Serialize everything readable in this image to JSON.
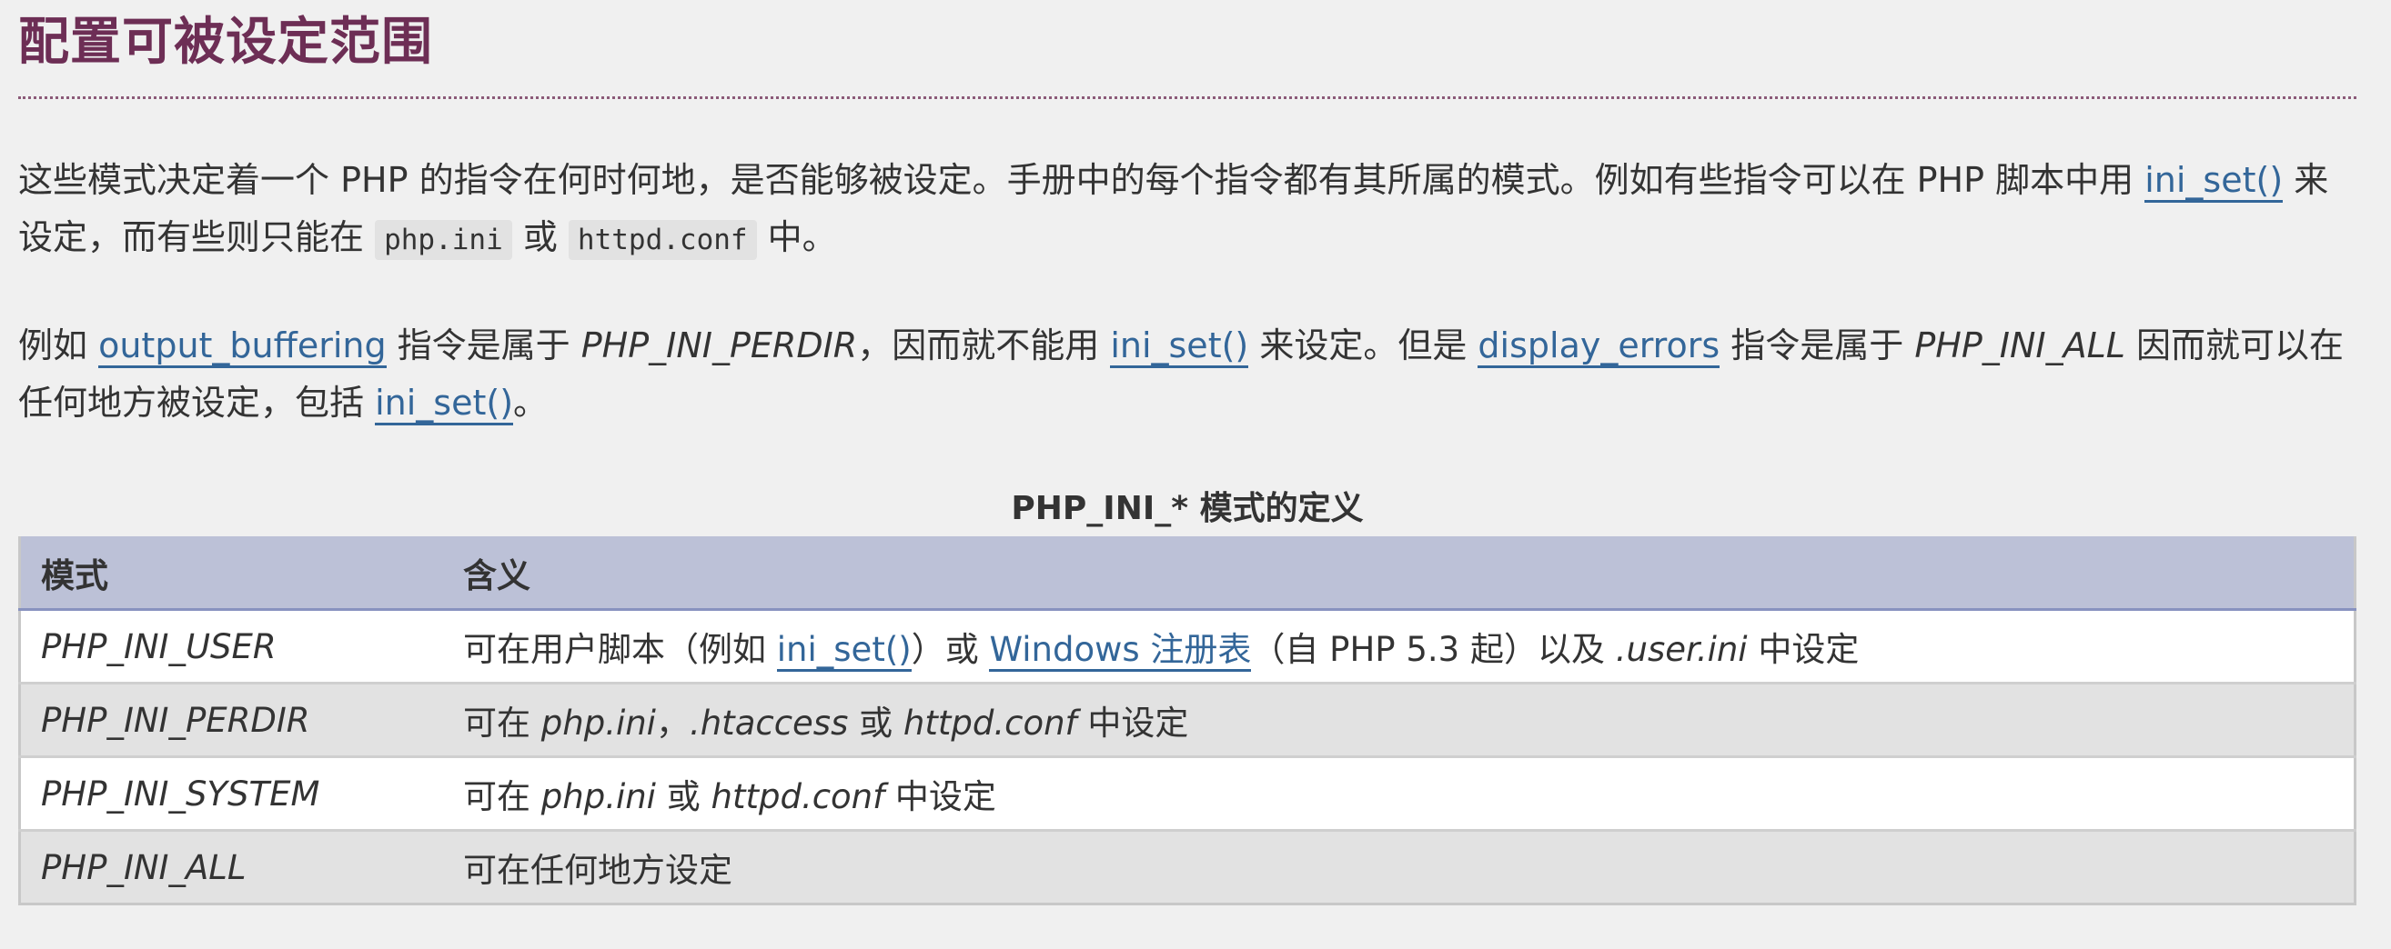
{
  "title": "配置可被设定范围",
  "colors": {
    "title": "#6d2e55",
    "link": "#336699",
    "table_header": "#bcc1d7"
  },
  "paragraph1": {
    "t1": "这些模式决定着一个 PHP 的指令在何时何地，是否能够被设定。手册中的每个指令都有其所属的模式。例如有些指令可以在 PHP 脚本中用 ",
    "link1": "ini_set()",
    "t2": " 来设定，而有些则只能在 ",
    "code1": "php.ini",
    "t3": " 或 ",
    "code2": "httpd.conf",
    "t4": " 中。"
  },
  "paragraph2": {
    "t1": "例如 ",
    "link1": "output_buffering",
    "t2": " 指令是属于 ",
    "em1": "PHP_INI_PERDIR",
    "t3": "，因而就不能用 ",
    "link2": "ini_set()",
    "t4": " 来设定。但是 ",
    "link3": "display_errors",
    "t5": " 指令是属于 ",
    "em2": "PHP_INI_ALL",
    "t6": " 因而就可以在任何地方被设定，包括 ",
    "link4": "ini_set()",
    "t7": "。"
  },
  "table": {
    "caption": "PHP_INI_* 模式的定义",
    "headers": [
      "模式",
      "含义"
    ],
    "rows": [
      {
        "mode": "PHP_INI_USER",
        "m": {
          "t1": "可在用户脚本（例如 ",
          "link1": "ini_set()",
          "t2": "）或 ",
          "link2": "Windows 注册表",
          "t3": "（自 PHP 5.3 起）以及 ",
          "em1": ".user.ini",
          "t4": " 中设定"
        }
      },
      {
        "mode": "PHP_INI_PERDIR",
        "m": {
          "t1": "可在 ",
          "em1": "php.ini",
          "t2": "，",
          "em2": ".htaccess",
          "t3": " 或 ",
          "em3": "httpd.conf",
          "t4": " 中设定"
        }
      },
      {
        "mode": "PHP_INI_SYSTEM",
        "m": {
          "t1": "可在 ",
          "em1": "php.ini",
          "t2": " 或 ",
          "em2": "httpd.conf",
          "t3": " 中设定"
        }
      },
      {
        "mode": "PHP_INI_ALL",
        "m": {
          "t1": "可在任何地方设定"
        }
      }
    ]
  }
}
